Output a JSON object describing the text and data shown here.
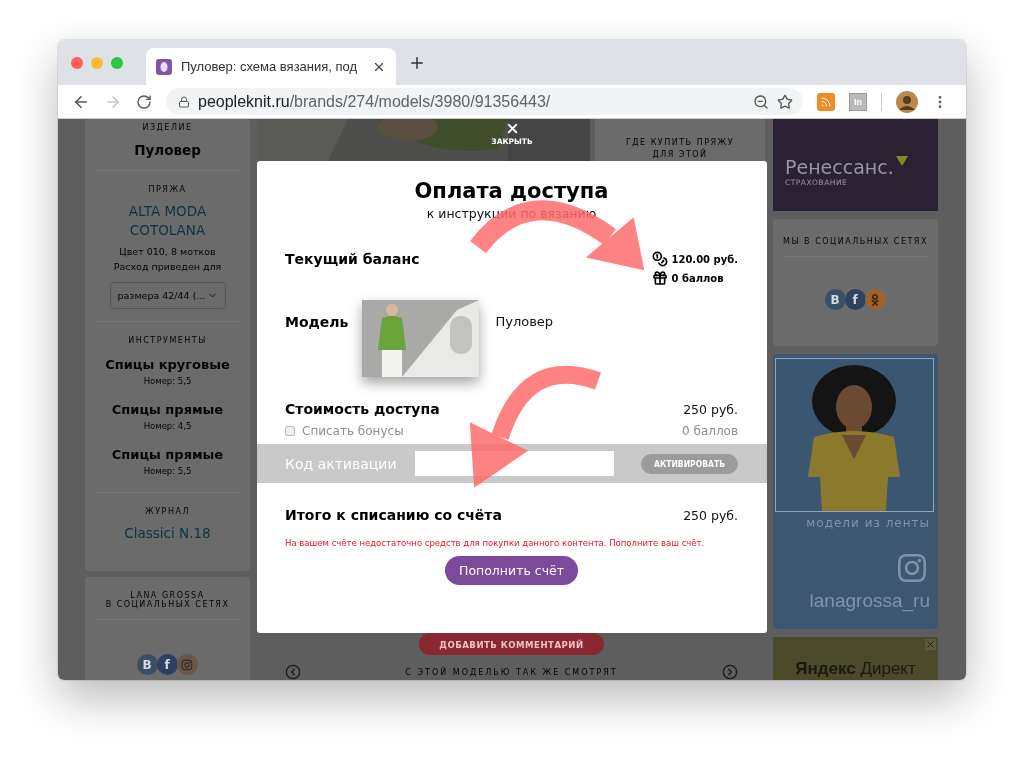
{
  "browser": {
    "tab_title": "Пуловер: схема вязания, под",
    "url": {
      "domain": "peopleknit.ru",
      "path": "/brands/274/models/3980/91356443/"
    },
    "forward_disabled": true,
    "extension_label": "In"
  },
  "sidebar": {
    "sections": [
      {
        "heading": "ИЗДЕЛИЕ",
        "items": [
          {
            "kind": "title",
            "text": "Пуловер"
          }
        ]
      },
      {
        "heading": "ПРЯЖА",
        "items": [
          {
            "kind": "link",
            "text": "ALTA MODA COTOLANA"
          },
          {
            "kind": "note",
            "text": "Цвет 010, 8 мотков"
          },
          {
            "kind": "note",
            "text": "Расход приведен для"
          },
          {
            "kind": "select",
            "text": "размера 42/44 (..."
          }
        ]
      },
      {
        "heading": "ИНСТРУМЕНТЫ",
        "items": [
          {
            "kind": "tool",
            "text": "Спицы круговые",
            "sub": "Номер: 5,5"
          },
          {
            "kind": "tool",
            "text": "Спицы прямые",
            "sub": "Номер: 4,5"
          },
          {
            "kind": "tool",
            "text": "Спицы прямые",
            "sub": "Номер: 5,5"
          }
        ]
      },
      {
        "heading": "ЖУРНАЛ",
        "items": [
          {
            "kind": "link",
            "text": "Classici N.18"
          }
        ]
      }
    ],
    "social": {
      "heading_lines": [
        "LANA GROSSA",
        "В СОЦИАЛЬНЫХ СЕТЯХ"
      ],
      "networks": [
        {
          "kind": "vk",
          "glyph": "B",
          "color": "#3a4f66"
        },
        {
          "kind": "facebook",
          "glyph": "f",
          "color": "#2e4160"
        },
        {
          "kind": "instagram",
          "color": "#6a5648"
        }
      ]
    }
  },
  "center": {
    "where_to_buy": [
      "ГДЕ КУПИТЬ ПРЯЖУ",
      "ДЛЯ ЭТОЙ"
    ],
    "comment_button": "ДОБАВИТЬ КОММЕНТАРИЙ",
    "similar_title": "С ЭТОЙ МОДЕЛЬЮ ТАК ЖЕ СМОТРЯТ"
  },
  "right": {
    "insurance_ad": {
      "brand": "Ренессанс.",
      "sub": "СТРАХОВАНИЕ"
    },
    "social": {
      "heading": "МЫ В СОЦИАЛЬНЫХ СЕТЯХ",
      "networks": [
        {
          "kind": "vk",
          "glyph": "B",
          "color": "#3a4f66"
        },
        {
          "kind": "facebook",
          "glyph": "f",
          "color": "#2e4160"
        },
        {
          "kind": "ok",
          "color": "#a0622c"
        }
      ]
    },
    "instagram_ad": {
      "caption": "модели из ленты",
      "handle": "lanagrossa_ru"
    },
    "yandex_ad": {
      "title": "**Яндекс** Директ"
    }
  },
  "close_label": "ЗАКРЫТЬ",
  "modal": {
    "title": "Оплата доступа",
    "subtitle": "к инструкции по вязанию",
    "balance": {
      "label": "Текущий баланс",
      "money": "120.00 руб.",
      "points": "0 баллов"
    },
    "model": {
      "label": "Модель",
      "name": "Пуловер"
    },
    "cost": {
      "label": "Стоимость доступа",
      "value": "250 руб."
    },
    "bonus": {
      "label": "Списать бонусы",
      "value": "0 баллов",
      "checked": false,
      "disabled": true
    },
    "activation": {
      "label": "Код активации",
      "button": "АКТИВИРОВАТЬ"
    },
    "total": {
      "label": "Итого к списанию со счёта",
      "value": "250 руб."
    },
    "warning": "На вашем счёте недостаточно средств для покупки данного контента. Пополните ваш счёт.",
    "button": "Пополнить счёт"
  }
}
